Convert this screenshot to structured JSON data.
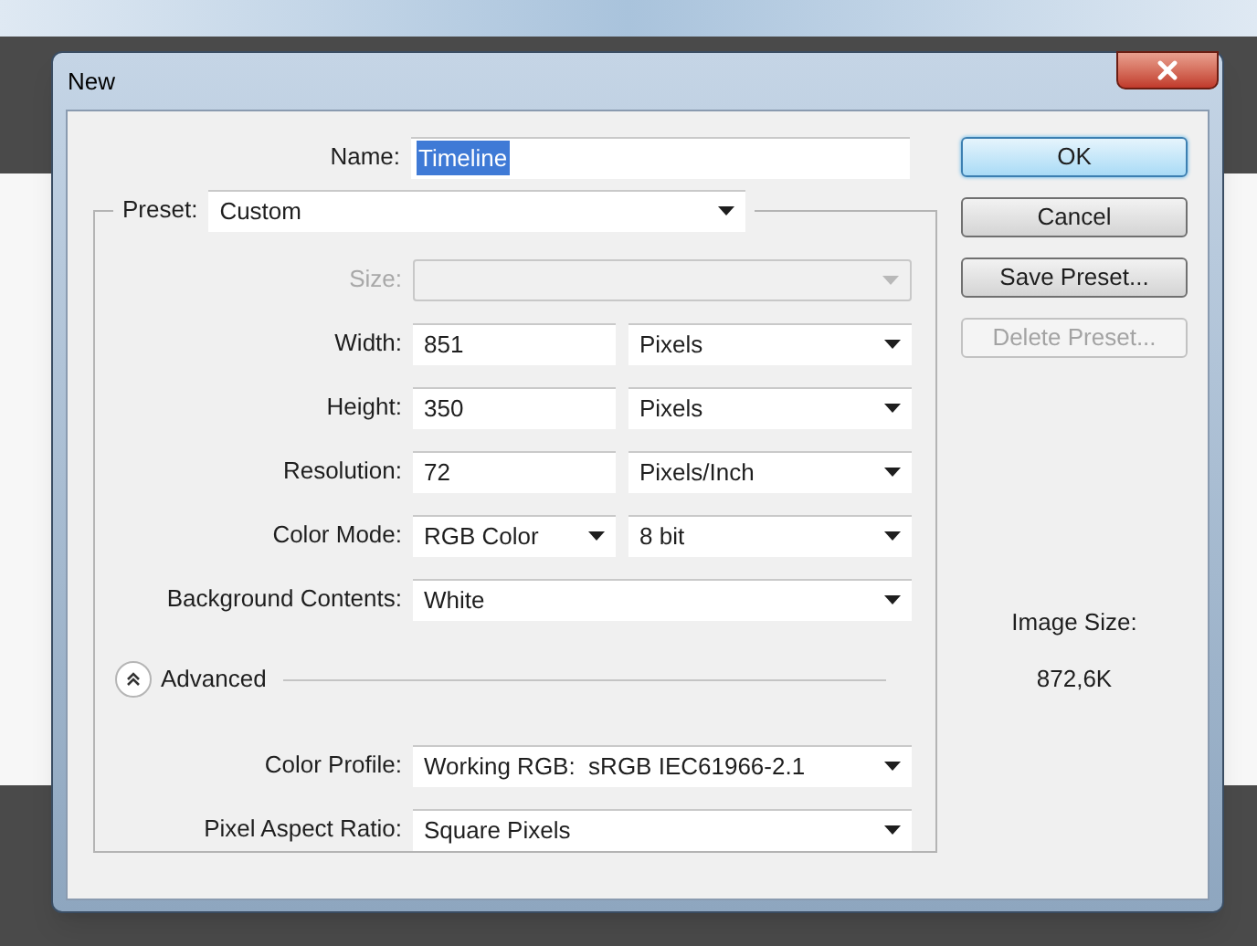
{
  "window": {
    "title": "New"
  },
  "name_field": {
    "label": "Name:",
    "value": "Timeline",
    "highlighted": true
  },
  "preset": {
    "label": "Preset:",
    "value": "Custom"
  },
  "rows": [
    {
      "kind": "dropdown",
      "label": "Size:",
      "disabled": true
    },
    {
      "kind": "input_unit",
      "label": "Width:",
      "value": "851",
      "unit": "Pixels"
    },
    {
      "kind": "input_unit",
      "label": "Height:",
      "value": "350",
      "unit": "Pixels"
    },
    {
      "kind": "input_unit",
      "label": "Resolution:",
      "value": "72",
      "unit": "Pixels/Inch"
    },
    {
      "kind": "pair",
      "label": "Color Mode:",
      "value": "RGB Color",
      "unit": "8 bit"
    },
    {
      "kind": "dropdown",
      "label": "Background Contents:",
      "value": "White",
      "disabled": false
    }
  ],
  "advanced": {
    "label": "Advanced",
    "expanded": true
  },
  "advanced_rows": [
    {
      "kind": "dropdown",
      "label": "Color Profile:",
      "value": "Working RGB:  sRGB IEC61966-2.1",
      "disabled": false
    },
    {
      "kind": "dropdown",
      "label": "Pixel Aspect Ratio:",
      "value": "Square Pixels",
      "disabled": false
    }
  ],
  "buttons": [
    {
      "label": "OK",
      "default": true,
      "disabled": false
    },
    {
      "label": "Cancel",
      "default": false,
      "disabled": false
    },
    {
      "label": "Save Preset...",
      "default": false,
      "disabled": false
    },
    {
      "label": "Delete Preset...",
      "default": false,
      "disabled": true
    }
  ],
  "image_size": {
    "label": "Image Size:",
    "value": "872,6K"
  }
}
